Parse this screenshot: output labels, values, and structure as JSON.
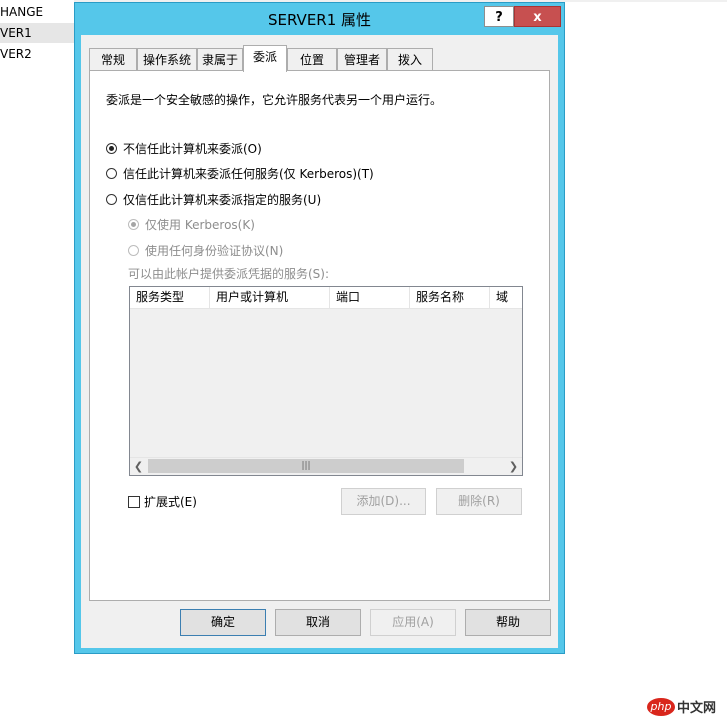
{
  "background_list": {
    "items": [
      "HANGE",
      "VER1",
      "VER2"
    ]
  },
  "window": {
    "title": "SERVER1 属性",
    "help_button": "?",
    "close_button": "x"
  },
  "tabs": [
    "常规",
    "操作系统",
    "隶属于",
    "委派",
    "位置",
    "管理者",
    "拨入"
  ],
  "delegation": {
    "description": "委派是一个安全敏感的操作，它允许服务代表另一个用户运行。",
    "options": [
      "不信任此计算机来委派(O)",
      "信任此计算机来委派任何服务(仅 Kerberos)(T)",
      "仅信任此计算机来委派指定的服务(U)"
    ],
    "sub_options": [
      "仅使用 Kerberos(K)",
      "使用任何身份验证协议(N)"
    ],
    "services_label": "可以由此帐户提供委派凭据的服务(S):",
    "columns": [
      "服务类型",
      "用户或计算机",
      "端口",
      "服务名称",
      "域"
    ],
    "expanded_label": "扩展式(E)",
    "add_button": "添加(D)...",
    "remove_button": "删除(R)"
  },
  "footer": {
    "ok": "确定",
    "cancel": "取消",
    "apply": "应用(A)",
    "help": "帮助"
  },
  "watermark": {
    "logo": "php",
    "text": "中文网"
  }
}
